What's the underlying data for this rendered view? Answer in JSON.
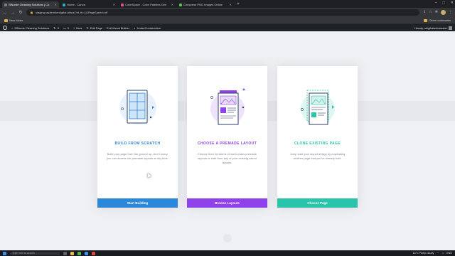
{
  "browser": {
    "tabs": [
      {
        "title": "SiNorde Cleaning Solutions | Co"
      },
      {
        "title": "Home - Canva"
      },
      {
        "title": "ColorSpace - Color Palettes Gen"
      },
      {
        "title": "Compress PNG Images Online"
      }
    ],
    "new_tab_glyph": "+",
    "url": "staging.septemberdigital.africa/?et_fb=1&PageSpeed=off",
    "bookmarks": {
      "new_folder": "New folder",
      "other": "Other bookmarks"
    }
  },
  "wp_admin": {
    "site_name": "SiNorde Cleaning Solutions",
    "updates_count": "5",
    "comments_count": "0",
    "new_label": "New",
    "edit_page": "Edit Page",
    "exit_builder": "Exit Visual Builder",
    "under_construction": "UnderConstruction",
    "howdy": "Howdy, sdigitalwebmaster"
  },
  "builder": {
    "cards": [
      {
        "title": "BUILD FROM SCRATCH",
        "title_color": "#2b87da",
        "description": "Build your page from the ground up. Don't worry, you can access our premade layouts at any time.",
        "button_label": "Start Building",
        "button_color": "#2b87da"
      },
      {
        "title": "CHOOSE A PREMADE LAYOUT",
        "title_color": "#8f42ec",
        "description": "Choose from hundreds of world-class premade layouts or start from any of your existing saved layouts.",
        "button_label": "Browse Layouts",
        "button_color": "#8f42ec"
      },
      {
        "title": "CLONE EXISTING PAGE",
        "title_color": "#29c4a9",
        "description": "Jump start your layout design by duplicating another page that you've already built.",
        "button_label": "Choose Page",
        "button_color": "#29c4a9"
      }
    ]
  },
  "taskbar": {
    "search_placeholder": "Type here to search",
    "weather": "14°C  Partly cloudy",
    "language": "ENG"
  }
}
